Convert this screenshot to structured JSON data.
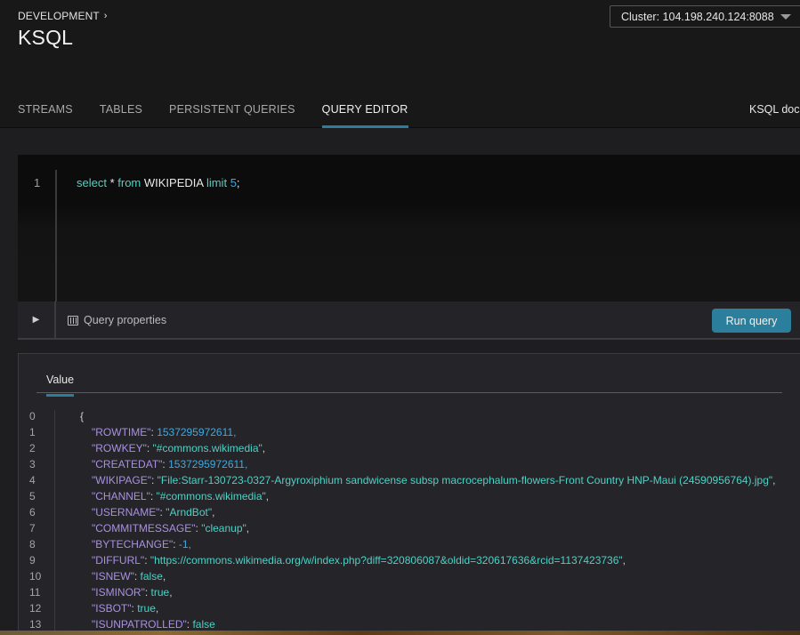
{
  "header": {
    "breadcrumb": "DEVELOPMENT",
    "breadcrumb_icon": "chevron-right-icon",
    "title": "KSQL",
    "cluster_select": "Cluster: 104.198.240.124:8088"
  },
  "tabs": [
    {
      "label": "STREAMS",
      "active": false
    },
    {
      "label": "TABLES",
      "active": false
    },
    {
      "label": "PERSISTENT QUERIES",
      "active": false
    },
    {
      "label": "QUERY EDITOR",
      "active": true
    }
  ],
  "docs_link": "KSQL docs",
  "editor": {
    "line_number": "1",
    "tokens": {
      "select": "select",
      "star": " * ",
      "from": "from",
      "table": " WIKIPEDIA ",
      "limit": "limit",
      "space": " ",
      "count": "5",
      "semicolon": ";"
    }
  },
  "toolbar": {
    "run_icon": "play-icon",
    "query_properties_icon": "sliders-icon",
    "query_properties": "Query properties",
    "run_query": "Run query"
  },
  "results": {
    "tab_label": "Value",
    "lines": [
      {
        "n": "0",
        "text": "{"
      },
      {
        "n": "1",
        "key": "\"ROWTIME\"",
        "value": "1537295972611",
        "type": "num",
        "comma": ","
      },
      {
        "n": "2",
        "key": "\"ROWKEY\"",
        "value": "\"#commons.wikimedia\"",
        "type": "str",
        "comma": ","
      },
      {
        "n": "3",
        "key": "\"CREATEDAT\"",
        "value": "1537295972611",
        "type": "num",
        "comma": ","
      },
      {
        "n": "4",
        "key": "\"WIKIPAGE\"",
        "value": "\"File:Starr-130723-0327-Argyroxiphium sandwicense subsp macrocephalum-flowers-Front Country HNP-Maui (24590956764).jpg\"",
        "type": "str",
        "comma": ","
      },
      {
        "n": "5",
        "key": "\"CHANNEL\"",
        "value": "\"#commons.wikimedia\"",
        "type": "str",
        "comma": ","
      },
      {
        "n": "6",
        "key": "\"USERNAME\"",
        "value": "\"ArndBot\"",
        "type": "str",
        "comma": ","
      },
      {
        "n": "7",
        "key": "\"COMMITMESSAGE\"",
        "value": "\"cleanup\"",
        "type": "str",
        "comma": ","
      },
      {
        "n": "8",
        "key": "\"BYTECHANGE\"",
        "value": "-1",
        "type": "num",
        "comma": ","
      },
      {
        "n": "9",
        "key": "\"DIFFURL\"",
        "value": "\"https://commons.wikimedia.org/w/index.php?diff=320806087&oldid=320617636&rcid=1137423736\"",
        "type": "str",
        "comma": ","
      },
      {
        "n": "10",
        "key": "\"ISNEW\"",
        "value": "false",
        "type": "bool",
        "comma": ","
      },
      {
        "n": "11",
        "key": "\"ISMINOR\"",
        "value": "true",
        "type": "bool",
        "comma": ","
      },
      {
        "n": "12",
        "key": "\"ISBOT\"",
        "value": "true",
        "type": "bool",
        "comma": ","
      },
      {
        "n": "13",
        "key": "\"ISUNPATROLLED\"",
        "value": "false",
        "type": "bool",
        "comma": ""
      }
    ]
  }
}
